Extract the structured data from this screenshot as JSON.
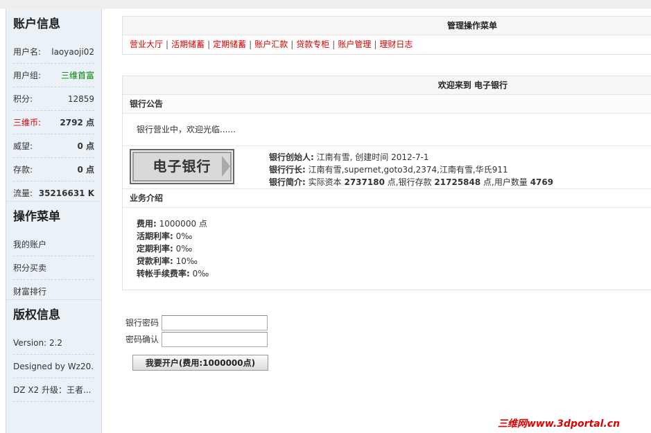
{
  "sidebar": {
    "account_title": "账户信息",
    "account_rows": [
      {
        "label": "用户名:",
        "value": "laoyaoji02"
      },
      {
        "label": "用户组:",
        "value": "三维首富"
      },
      {
        "label": "积分:",
        "value": "12859"
      },
      {
        "label": "三维币:",
        "value": "2792 点"
      },
      {
        "label": "威望:",
        "value": "0 点"
      },
      {
        "label": "存款:",
        "value": "0 点"
      },
      {
        "label": "流量:",
        "value": "35216631 K"
      }
    ],
    "menu_title": "操作菜单",
    "menu_items": [
      "我的账户",
      "积分买卖",
      "财富排行"
    ],
    "copyright_title": "版权信息",
    "copyright_items": [
      "Version: 2.2",
      "Designed by Wz20...",
      "DZ X2 升级：王者..."
    ]
  },
  "nav": {
    "title": "管理操作菜单",
    "items": [
      "营业大厅",
      "活期储蓄",
      "定期储蓄",
      "账户汇款",
      "贷款专柜",
      "账户管理",
      "理财日志"
    ],
    "separator": "|"
  },
  "welcome": {
    "title": "欢迎来到 电子银行",
    "notice_heading": "银行公告",
    "notice_text": "银行营业中，欢迎光临......",
    "logo_text": "电子银行",
    "founder_label": "银行创始人:",
    "founder_value": "江南有雪, 创建时间 2012-7-1",
    "president_label": "银行行长:",
    "president_value": "江南有雪,supernet,goto3d,2374,江南有雪,华氏911",
    "brief_label": "银行简介:",
    "brief_t1": "实际资本",
    "brief_capital": "2737180",
    "brief_t2": "点,银行存款",
    "brief_deposit": "21725848",
    "brief_t3": "点,用户数量",
    "brief_users": "4769",
    "intro_heading": "业务介绍",
    "fee_label": "费用:",
    "fee_value": "1000000 点",
    "demand_label": "活期利率:",
    "demand_value": "0‰",
    "fixed_label": "定期利率:",
    "fixed_value": "0‰",
    "loan_label": "贷款利率:",
    "loan_value": "10‰",
    "transfer_label": "转帐手续费率:",
    "transfer_value": "0‰"
  },
  "form": {
    "password_label": "银行密码",
    "confirm_label": "密码确认",
    "password_value": "",
    "confirm_value": "",
    "submit_label": "我要开户(费用:1000000点)"
  },
  "watermark": "三维网www.3dportal.cn",
  "colors": {
    "link_red": "#d40000",
    "group_green": "#008000",
    "sidebar_bg": "#eaf1f7"
  }
}
